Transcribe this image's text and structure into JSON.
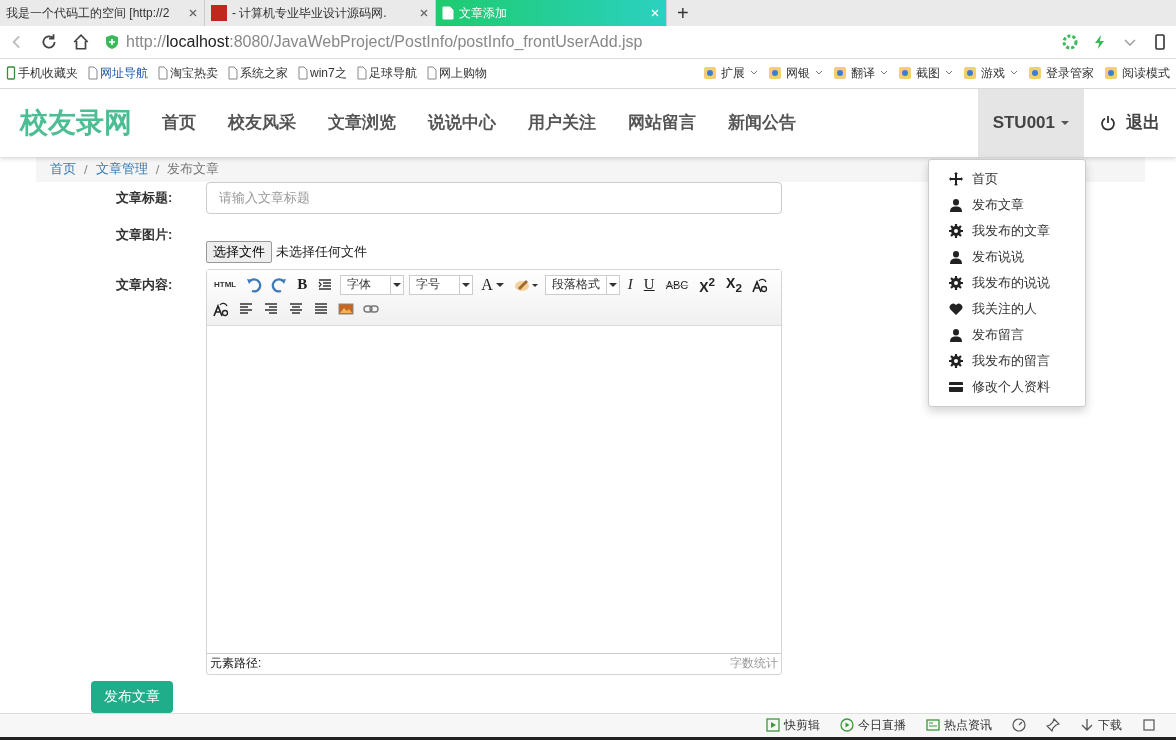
{
  "browser": {
    "tabs": [
      {
        "title": "我是一个代码工的空间 [http://2",
        "kind": "none",
        "selected": false
      },
      {
        "title": "- 计算机专业毕业设计源码网.",
        "kind": "site",
        "selected": false
      },
      {
        "title": "文章添加",
        "kind": "page",
        "selected": true
      }
    ],
    "new_tab": "+",
    "url": {
      "scheme": "http://",
      "host": "localhost",
      "path": ":8080/JavaWebProject/PostInfo/postInfo_frontUserAdd.jsp"
    },
    "bookmarks_left": [
      {
        "label": "手机收藏夹",
        "kind": "phone"
      },
      {
        "label": "网址导航",
        "kind": "nav"
      },
      {
        "label": "淘宝热卖",
        "kind": "page"
      },
      {
        "label": "系统之家",
        "kind": "page"
      },
      {
        "label": "win7之",
        "kind": "page"
      },
      {
        "label": "足球导航",
        "kind": "page"
      },
      {
        "label": "网上购物",
        "kind": "page"
      }
    ],
    "bookmarks_right": [
      {
        "label": "扩展",
        "menu": true
      },
      {
        "label": "网银",
        "menu": true
      },
      {
        "label": "翻译",
        "menu": true
      },
      {
        "label": "截图",
        "menu": true
      },
      {
        "label": "游戏",
        "menu": true
      },
      {
        "label": "登录管家",
        "menu": false
      },
      {
        "label": "阅读模式",
        "menu": false
      }
    ]
  },
  "site": {
    "brand": "校友录网",
    "nav": [
      "首页",
      "校友风采",
      "文章浏览",
      "说说中心",
      "用户关注",
      "网站留言",
      "新闻公告"
    ],
    "user": {
      "name": "STU001",
      "expanded": true
    },
    "logout": "退出",
    "user_menu": [
      {
        "label": "首页",
        "kind": "move"
      },
      {
        "label": "发布文章",
        "kind": "user"
      },
      {
        "label": "我发布的文章",
        "kind": "gear"
      },
      {
        "label": "发布说说",
        "kind": "user"
      },
      {
        "label": "我发布的说说",
        "kind": "gear"
      },
      {
        "label": "我关注的人",
        "kind": "heart"
      },
      {
        "label": "发布留言",
        "kind": "user"
      },
      {
        "label": "我发布的留言",
        "kind": "gear"
      },
      {
        "label": "修改个人资料",
        "kind": "card"
      }
    ]
  },
  "breadcrumb": [
    {
      "kind": "link",
      "text": "首页"
    },
    {
      "kind": "sep",
      "text": "/"
    },
    {
      "kind": "link",
      "text": "文章管理"
    },
    {
      "kind": "sep",
      "text": "/"
    },
    {
      "kind": "current",
      "text": "发布文章"
    }
  ],
  "form": {
    "title_label": "文章标题:",
    "title_placeholder": "请输入文章标题",
    "image_label": "文章图片:",
    "file_button": "选择文件",
    "file_status": "未选择任何文件",
    "content_label": "文章内容:",
    "editor": {
      "toolbar": [
        [
          {
            "kind": "html",
            "text": "HTML"
          },
          {
            "kind": "undo"
          },
          {
            "kind": "redo"
          },
          {
            "kind": "bold",
            "text": "B"
          },
          {
            "kind": "indent"
          },
          {
            "kind": "select",
            "text": "字体"
          },
          {
            "kind": "select",
            "text": "字号"
          },
          {
            "kind": "fontcolor",
            "text": "A"
          },
          {
            "kind": "highlight"
          },
          {
            "kind": "select",
            "text": "段落格式"
          },
          {
            "kind": "italic",
            "text": "I"
          },
          {
            "kind": "underline",
            "text": "U"
          },
          {
            "kind": "strike",
            "text": "ABC"
          },
          {
            "kind": "script",
            "text": "X$^{2}$"
          },
          {
            "kind": "script",
            "text": "X$_{2}$"
          },
          {
            "kind": "case"
          }
        ],
        [
          {
            "kind": "case"
          },
          {
            "kind": "alignleft"
          },
          {
            "kind": "alignright"
          },
          {
            "kind": "aligncenter"
          },
          {
            "kind": "justify"
          },
          {
            "kind": "image"
          },
          {
            "kind": "link"
          }
        ]
      ],
      "path_label": "元素路径:",
      "word_count": "字数统计"
    },
    "submit": "发布文章"
  },
  "status_bar": [
    {
      "kind": "clip",
      "label": "快剪辑"
    },
    {
      "kind": "live",
      "label": "今日直播"
    },
    {
      "kind": "news",
      "label": "热点资讯"
    },
    {
      "kind": "speed"
    },
    {
      "kind": "pin"
    },
    {
      "kind": "download",
      "label": "下载"
    },
    {
      "kind": "window"
    }
  ]
}
